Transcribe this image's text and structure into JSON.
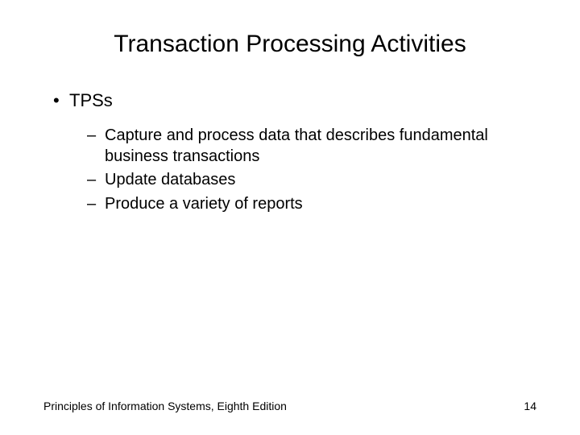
{
  "slide": {
    "title": "Transaction Processing Activities",
    "bullets": {
      "l1": "TPSs",
      "l2_0": "Capture and process data that describes fundamental business transactions",
      "l2_1": "Update databases",
      "l2_2": "Produce a variety of reports"
    },
    "footer_text": "Principles of Information Systems, Eighth Edition",
    "page_number": "14"
  }
}
